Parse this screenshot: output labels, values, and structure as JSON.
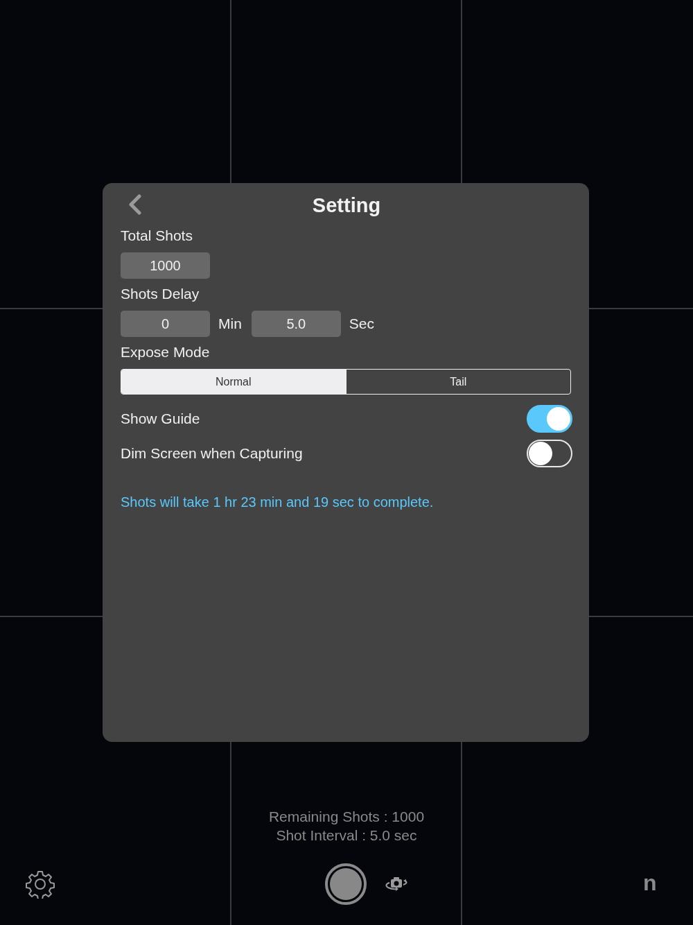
{
  "settings_panel": {
    "title": "Setting",
    "total_shots": {
      "label": "Total Shots",
      "value": "1000"
    },
    "shots_delay": {
      "label": "Shots Delay",
      "minutes": {
        "value": "0",
        "unit": "Min"
      },
      "seconds": {
        "value": "5.0",
        "unit": "Sec"
      }
    },
    "expose_mode": {
      "label": "Expose Mode",
      "options": [
        {
          "label": "Normal",
          "selected": true
        },
        {
          "label": "Tail",
          "selected": false
        }
      ]
    },
    "toggles": [
      {
        "label": "Show Guide",
        "on": true
      },
      {
        "label": "Dim Screen when Capturing",
        "on": false
      }
    ],
    "info": "Shots will take 1 hr 23 min and 19 sec to complete."
  },
  "status": [
    "Remaining Shots : 1000",
    "Shot Interval : 5.0 sec"
  ],
  "toolbar": {
    "brand_key": "n"
  }
}
